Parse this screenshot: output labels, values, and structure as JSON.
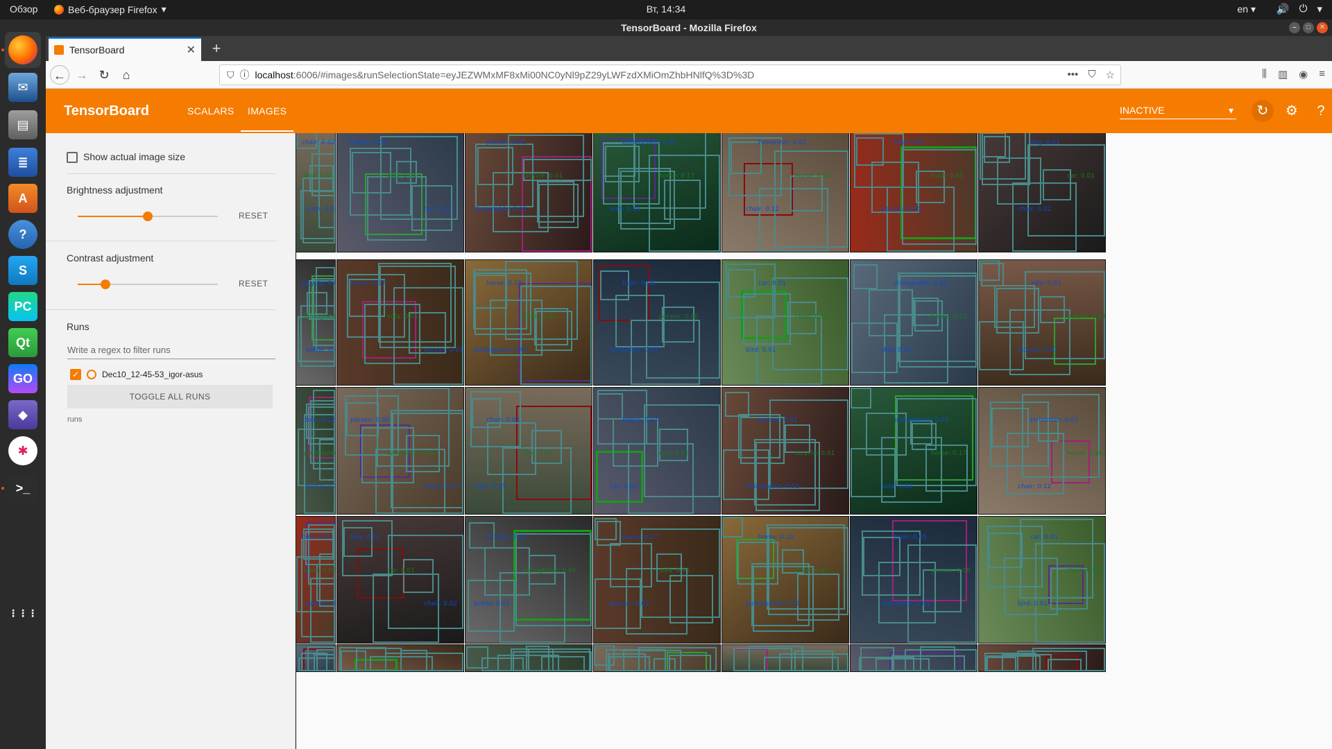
{
  "topbar": {
    "overview": "Обзор",
    "app_menu": "Веб-браузер Firefox",
    "clock": "Вт, 14:34",
    "lang": "en"
  },
  "window": {
    "title": "TensorBoard - Mozilla Firefox"
  },
  "browser": {
    "tab_title": "TensorBoard",
    "url_host": "localhost",
    "url_path": ":6006/#images&runSelectionState=eyJEZWMxMF8xMi00NC0yNl9pZ29yLWFzdXMiOmZhbHNlfQ%3D%3D"
  },
  "tensorboard": {
    "brand": "TensorBoard",
    "tabs": [
      {
        "label": "SCALARS",
        "selected": false
      },
      {
        "label": "IMAGES",
        "selected": true
      }
    ],
    "status": "INACTIVE",
    "accent": "#f57c00"
  },
  "sidebar": {
    "show_actual_size": "Show actual image size",
    "brightness": {
      "label": "Brightness adjustment",
      "reset": "RESET",
      "value": 0.5
    },
    "contrast": {
      "label": "Contrast adjustment",
      "reset": "RESET",
      "value": 0.2
    },
    "runs_heading": "Runs",
    "regex_placeholder": "Write a regex to filter runs",
    "run_name": "Dec10_12-45-53_igor-asus",
    "toggle_all": "TOGGLE ALL RUNS",
    "runs_tag": "runs"
  },
  "grid": {
    "labels": [
      "chair: 0.02",
      "bottle: 0.01",
      "person: 0.01",
      "pottedplant: 0.01",
      "tvmonitor: 0.01",
      "bird: 0.01",
      "dog: 0.01",
      "bicycle: 0.01",
      "horse: 0.17",
      "horse: 0.10",
      "train: 0.05",
      "car: 0.01",
      "diningtable: 0.01",
      "sofa: 0.01",
      "chair: 0.12",
      "person: 0.00"
    ],
    "dock_icons": [
      "firefox-icon",
      "thunderbird-icon",
      "files-icon",
      "writer-icon",
      "software-icon",
      "help-icon",
      "skype-icon",
      "pycharm-icon",
      "qt-icon",
      "goland-icon",
      "diamond-icon",
      "slack-icon",
      "terminal-icon",
      "apps-grid-icon"
    ]
  }
}
